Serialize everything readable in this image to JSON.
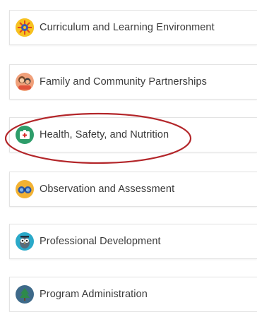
{
  "items": [
    {
      "label": "Curriculum and Learning Environment",
      "icon": "sun-gear-icon",
      "color": "#f5a623"
    },
    {
      "label": "Family and Community Partnerships",
      "icon": "family-icon",
      "color": "#e8734a"
    },
    {
      "label": "Health, Safety, and Nutrition",
      "icon": "first-aid-icon",
      "color": "#2e9d6a"
    },
    {
      "label": "Observation and Assessment",
      "icon": "binoculars-icon",
      "color": "#f2b233"
    },
    {
      "label": "Professional Development",
      "icon": "owl-icon",
      "color": "#2aa9c9"
    },
    {
      "label": "Program Administration",
      "icon": "tree-icon",
      "color": "#3e6a8a"
    }
  ],
  "highlight": {
    "target": "Health, Safety, and Nutrition",
    "color": "#b3262a"
  }
}
